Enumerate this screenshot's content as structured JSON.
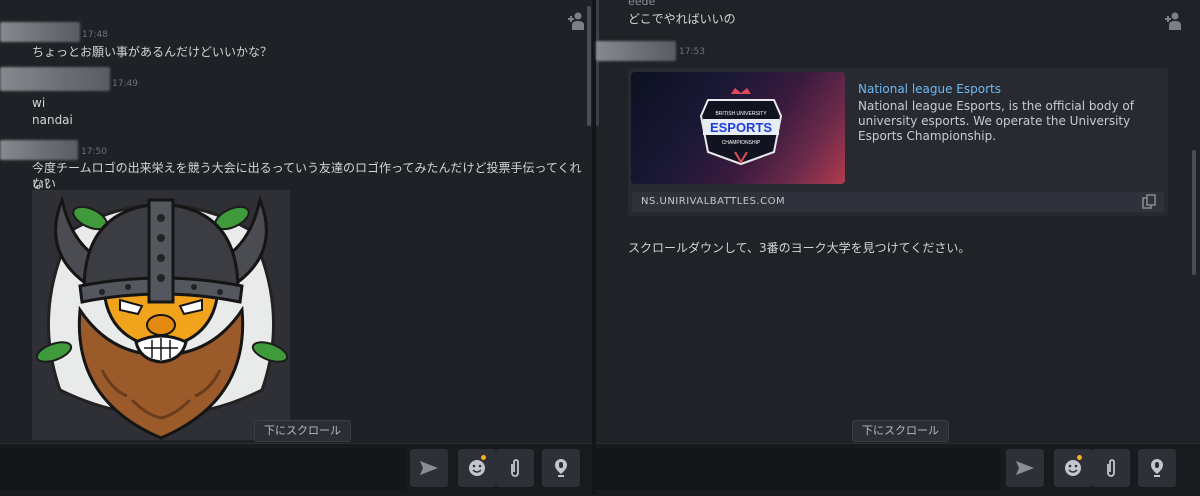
{
  "left": {
    "messages": [
      {
        "time": "17:48",
        "lines": [
          "ちょっとお願い事があるんだけどいいかな？"
        ]
      },
      {
        "time": "17:49",
        "lines": [
          "wi",
          "nandai"
        ]
      },
      {
        "time": "17:50",
        "lines": [
          "今度チームロゴの出来栄えを競う大会に出るっていう友達のロゴ作ってみたんだけど投票手伝ってくれない",
          "い？"
        ]
      }
    ],
    "scroll_down_label": "下にスクロール"
  },
  "right": {
    "prev_sender": "eede",
    "prev_message": "どこでやればいいの",
    "message_time": "17:53",
    "embed": {
      "title": "National league Esports",
      "description": "National league Esports, is the official body of university esports. We operate the University Esports Championship.",
      "url": "NS.UNIRIVALBATTLES.COM",
      "logo_top_text": "BRITISH UNIVERSITY",
      "logo_main_text": "ESPORTS",
      "logo_bottom_text": "CHAMPIONSHIP"
    },
    "instruction": "スクロールダウンして、3番のヨーク大学を見つけてください。",
    "scroll_down_label": "下にスクロール"
  },
  "icons": {
    "send": "send-icon",
    "emoji": "emoji-icon",
    "attach": "paperclip-icon",
    "voice": "microphone-icon",
    "add_user": "add-user-icon",
    "copy": "copy-icon"
  },
  "colors": {
    "link": "#6db9f3",
    "notification": "#f3b21a"
  }
}
